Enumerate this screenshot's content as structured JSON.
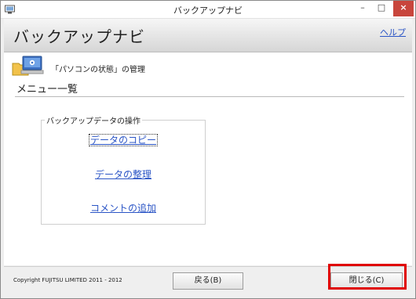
{
  "window": {
    "title": "バックアップナビ",
    "min_glyph": "–",
    "max_glyph": "□",
    "close_glyph": "×"
  },
  "header": {
    "app_title": "バックアップナビ",
    "help_link": "ヘルプ"
  },
  "content": {
    "section_caption": "「パソコンの状態」の管理",
    "menu_heading": "メニュー一覧",
    "group_title": "バックアップデータの操作",
    "menu_links": [
      "データのコピー",
      "データの整理",
      "コメントの追加"
    ]
  },
  "footer": {
    "copyright": "Copyright FUJITSU LIMITED 2011 - 2012",
    "back_button": "戻る(B)",
    "close_button": "閉じる(C)"
  },
  "colors": {
    "link": "#2b55c6",
    "highlight": "#e00000"
  }
}
